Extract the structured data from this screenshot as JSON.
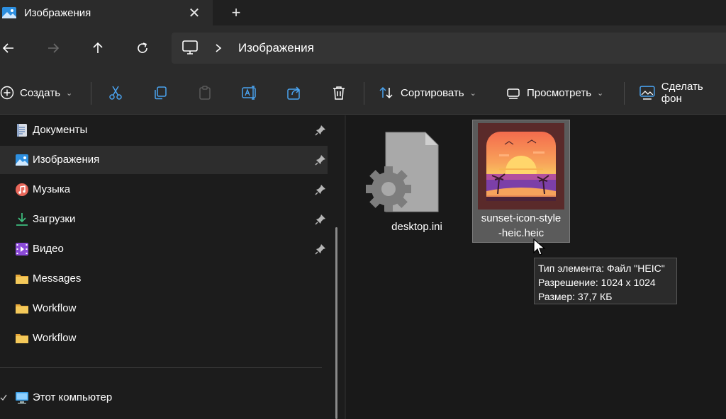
{
  "window": {
    "tab_title": "Изображения",
    "close_symbol": "✕",
    "new_tab_symbol": "+"
  },
  "address": {
    "crumb": "Изображения"
  },
  "toolbar": {
    "create_label": "Создать",
    "sort_label": "Сортировать",
    "view_label": "Просмотреть",
    "wallpaper_label": "Сделать фон",
    "dropdown_symbol": "⌄"
  },
  "sidebar": {
    "items": [
      {
        "label": "Документы",
        "icon": "documents-icon",
        "pinned": true
      },
      {
        "label": "Изображения",
        "icon": "pictures-icon",
        "pinned": true,
        "selected": true
      },
      {
        "label": "Музыка",
        "icon": "music-icon",
        "pinned": true
      },
      {
        "label": "Загрузки",
        "icon": "downloads-icon",
        "pinned": true
      },
      {
        "label": "Видео",
        "icon": "video-icon",
        "pinned": true
      },
      {
        "label": "Messages",
        "icon": "folder-icon",
        "pinned": false
      },
      {
        "label": "Workflow",
        "icon": "folder-icon",
        "pinned": false
      },
      {
        "label": "Workflow",
        "icon": "folder-icon",
        "pinned": false
      }
    ],
    "this_pc": "Этот компьютер"
  },
  "files": [
    {
      "name": "desktop.ini",
      "icon": "settings-file-icon"
    },
    {
      "name_line1": "sunset-icon-style",
      "name_line2": "-heic.heic",
      "icon": "sunset-image-thumbnail",
      "selected": true
    }
  ],
  "tooltip": {
    "type": "Тип элемента: Файл \"HEIC\"",
    "resolution": "Разрешение: 1024 x 1024",
    "size": "Размер: 37,7 КБ"
  },
  "colors": {
    "accent": "#4aa3f0",
    "folder": "#f4c95a"
  }
}
